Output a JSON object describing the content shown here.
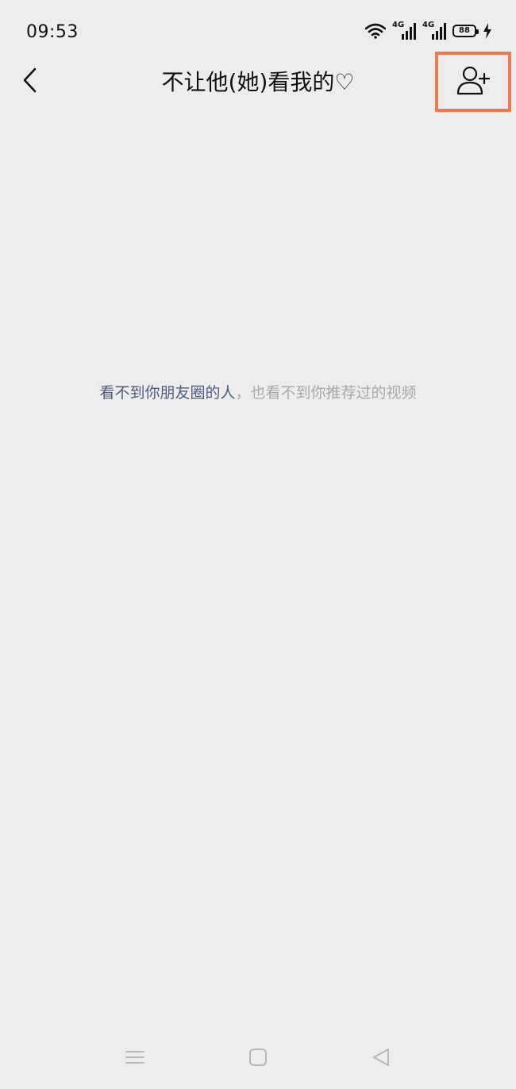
{
  "status_bar": {
    "time": "09:53",
    "signal1_label": "4G",
    "signal2_label": "4G",
    "battery_level": "88"
  },
  "header": {
    "title": "不让他(她)看我的♡"
  },
  "empty_state": {
    "highlight": "看不到你朋友圈的人",
    "separator": "，",
    "rest": "也看不到你推荐过的视频"
  },
  "colors": {
    "background": "#ededed",
    "highlight_text": "#4e5b7e",
    "secondary_text": "#a9a9a9",
    "annotation_box": "#ef7a4f"
  },
  "icons": {
    "back": "chevron-left-icon",
    "add_user": "add-user-icon",
    "menu": "menu-icon",
    "home": "home-icon",
    "nav_back": "triangle-back-icon"
  }
}
